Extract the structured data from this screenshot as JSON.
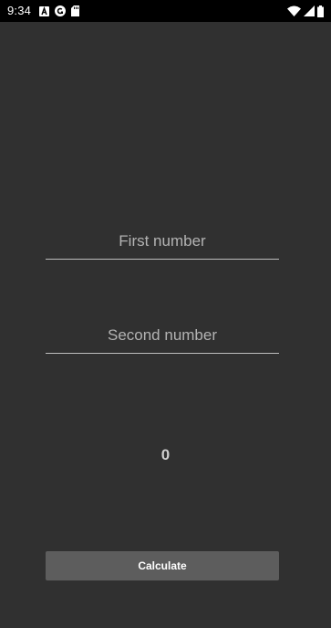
{
  "status_bar": {
    "time": "9:34",
    "left_icons": [
      "notification-a-icon",
      "notification-c-icon",
      "sd-card-icon"
    ],
    "right_icons": [
      "wifi-icon",
      "cell-signal-icon",
      "battery-icon"
    ]
  },
  "form": {
    "first_placeholder": "First number",
    "first_value": "",
    "second_placeholder": "Second number",
    "second_value": "",
    "result": "0",
    "calculate_label": "Calculate"
  },
  "colors": {
    "app_background": "#303030",
    "status_bar_background": "#000000",
    "button_background": "#5d5d5d",
    "underline": "#bdbdbd"
  }
}
